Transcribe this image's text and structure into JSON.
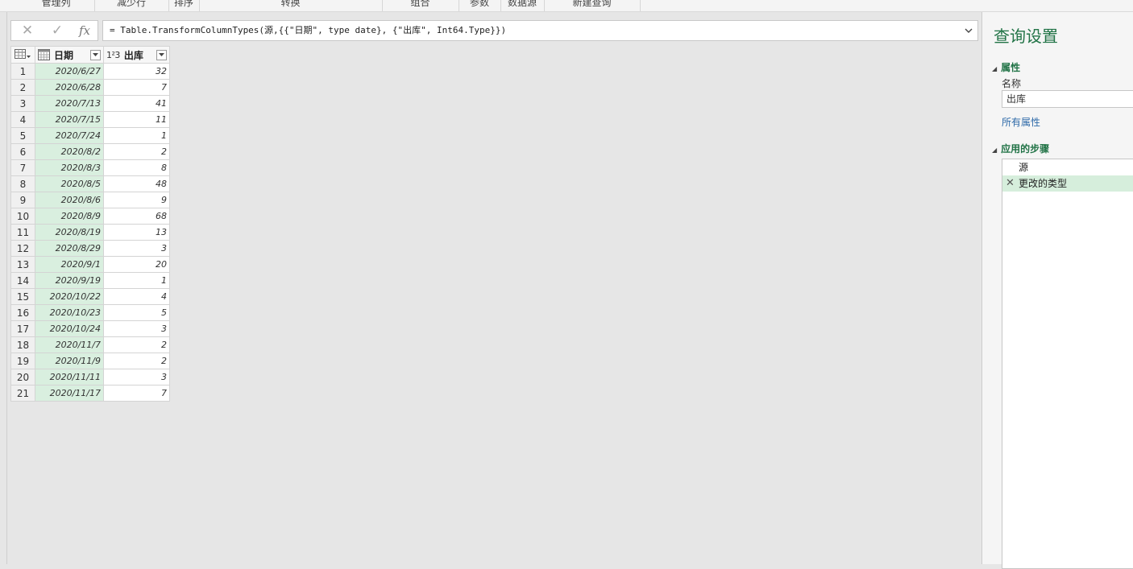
{
  "ribbon": {
    "groups": [
      "管理列",
      "减少行",
      "排序",
      "转换",
      "组合",
      "参数",
      "数据源",
      "新建查询"
    ]
  },
  "formula_bar": {
    "cancel_icon": "close-icon",
    "confirm_icon": "check-icon",
    "fx_label": "fx",
    "formula": "= Table.TransformColumnTypes(源,{{\"日期\", type date}, {\"出库\", Int64.Type}})"
  },
  "grid": {
    "columns": [
      {
        "label": "日期",
        "type_icon": "calendar-icon"
      },
      {
        "label": "出库",
        "type_icon": "1²3"
      }
    ],
    "rows": [
      {
        "n": "1",
        "date": "2020/6/27",
        "out": "32"
      },
      {
        "n": "2",
        "date": "2020/6/28",
        "out": "7"
      },
      {
        "n": "3",
        "date": "2020/7/13",
        "out": "41"
      },
      {
        "n": "4",
        "date": "2020/7/15",
        "out": "11"
      },
      {
        "n": "5",
        "date": "2020/7/24",
        "out": "1"
      },
      {
        "n": "6",
        "date": "2020/8/2",
        "out": "2"
      },
      {
        "n": "7",
        "date": "2020/8/3",
        "out": "8"
      },
      {
        "n": "8",
        "date": "2020/8/5",
        "out": "48"
      },
      {
        "n": "9",
        "date": "2020/8/6",
        "out": "9"
      },
      {
        "n": "10",
        "date": "2020/8/9",
        "out": "68"
      },
      {
        "n": "11",
        "date": "2020/8/19",
        "out": "13"
      },
      {
        "n": "12",
        "date": "2020/8/29",
        "out": "3"
      },
      {
        "n": "13",
        "date": "2020/9/1",
        "out": "20"
      },
      {
        "n": "14",
        "date": "2020/9/19",
        "out": "1"
      },
      {
        "n": "15",
        "date": "2020/10/22",
        "out": "4"
      },
      {
        "n": "16",
        "date": "2020/10/23",
        "out": "5"
      },
      {
        "n": "17",
        "date": "2020/10/24",
        "out": "3"
      },
      {
        "n": "18",
        "date": "2020/11/7",
        "out": "2"
      },
      {
        "n": "19",
        "date": "2020/11/9",
        "out": "2"
      },
      {
        "n": "20",
        "date": "2020/11/11",
        "out": "3"
      },
      {
        "n": "21",
        "date": "2020/11/17",
        "out": "7"
      }
    ]
  },
  "settings": {
    "title": "查询设置",
    "properties_heading": "属性",
    "name_label": "名称",
    "name_value": "出库",
    "all_properties_link": "所有属性",
    "steps_heading": "应用的步骤",
    "steps": [
      {
        "label": "源",
        "active": false
      },
      {
        "label": "更改的类型",
        "active": true
      }
    ]
  },
  "colors": {
    "accent_green": "#217346",
    "selected_step": "#d6eedc",
    "date_column": "#d9efdf",
    "link_blue": "#2e6aa8"
  }
}
